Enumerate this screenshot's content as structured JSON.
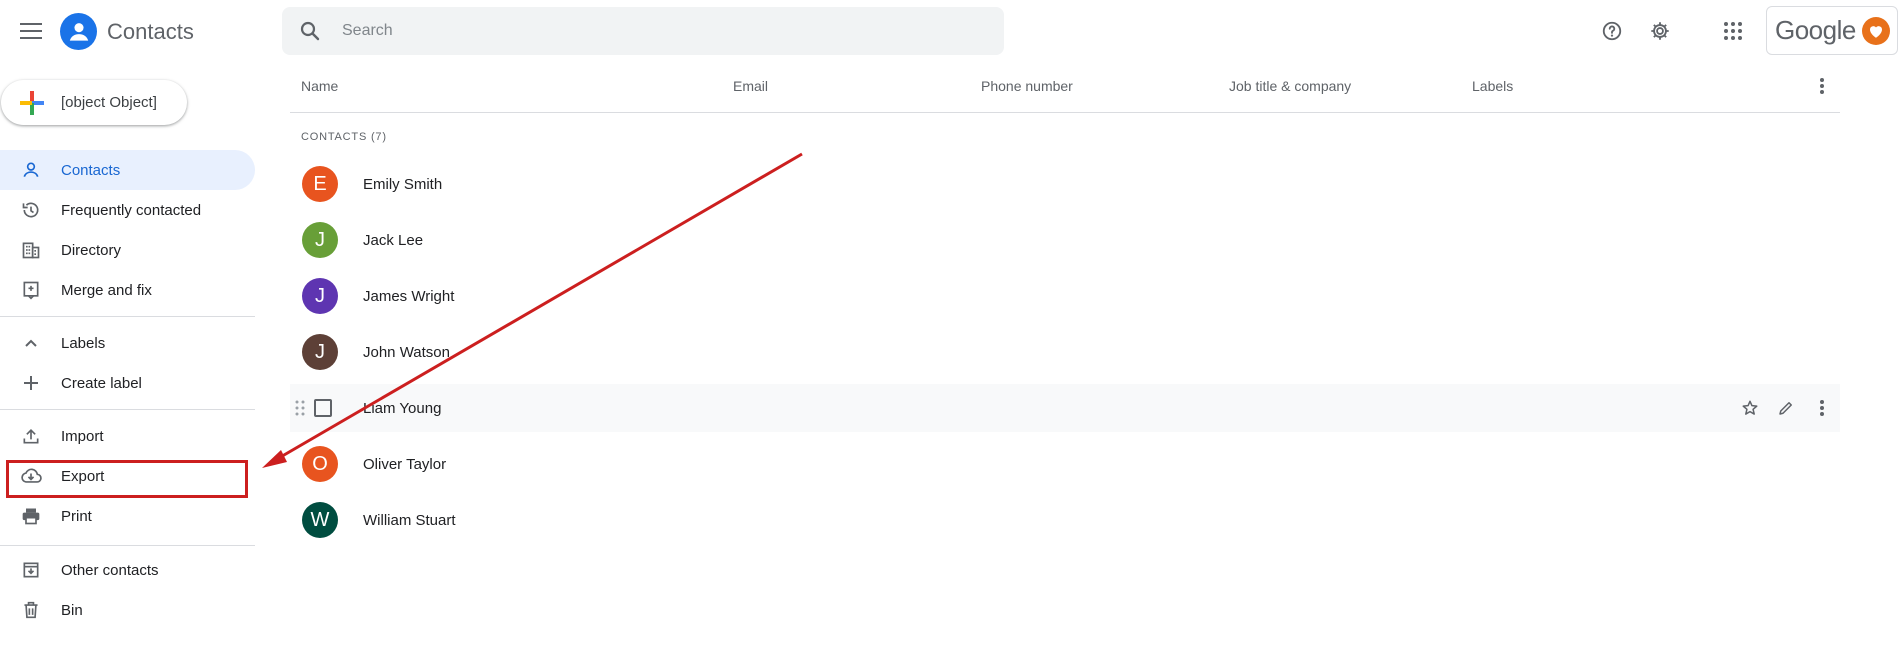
{
  "header": {
    "app_title": "Contacts",
    "search_placeholder": "Search",
    "brand": "Google"
  },
  "sidebar": {
    "create_label": {
      "label": "Create label",
      "icon": "plus-icon"
    },
    "items": [
      {
        "label": "Contacts",
        "icon": "person-icon",
        "active": true
      },
      {
        "label": "Frequently contacted",
        "icon": "history-icon"
      },
      {
        "label": "Directory",
        "icon": "building-icon"
      },
      {
        "label": "Merge and fix",
        "icon": "merge-icon"
      }
    ],
    "labels_section": {
      "label": "Labels",
      "icon": "chevron-up-icon"
    },
    "tools": [
      {
        "label": "Import",
        "icon": "upload-icon"
      },
      {
        "label": "Export",
        "icon": "cloud-download-icon"
      },
      {
        "label": "Print",
        "icon": "printer-icon"
      }
    ],
    "other": [
      {
        "label": "Other contacts",
        "icon": "archive-icon"
      },
      {
        "label": "Bin",
        "icon": "trash-icon"
      }
    ]
  },
  "table": {
    "columns": [
      "Name",
      "Email",
      "Phone number",
      "Job title & company",
      "Labels"
    ],
    "count_label": "CONTACTS (7)",
    "rows": [
      {
        "initial": "E",
        "name": "Emily Smith",
        "color": "#e8541f"
      },
      {
        "initial": "J",
        "name": "Jack Lee",
        "color": "#689f38"
      },
      {
        "initial": "J",
        "name": "James Wright",
        "color": "#5e35b1"
      },
      {
        "initial": "J",
        "name": "John Watson",
        "color": "#5d4037"
      },
      {
        "initial": "",
        "name": "Liam Young",
        "color": "",
        "hovered": true
      },
      {
        "initial": "O",
        "name": "Oliver Taylor",
        "color": "#e8541f"
      },
      {
        "initial": "W",
        "name": "William Stuart",
        "color": "#004d40"
      }
    ]
  },
  "colors": {
    "accent": "#1a73e8",
    "annotation": "#cc1f1f"
  }
}
